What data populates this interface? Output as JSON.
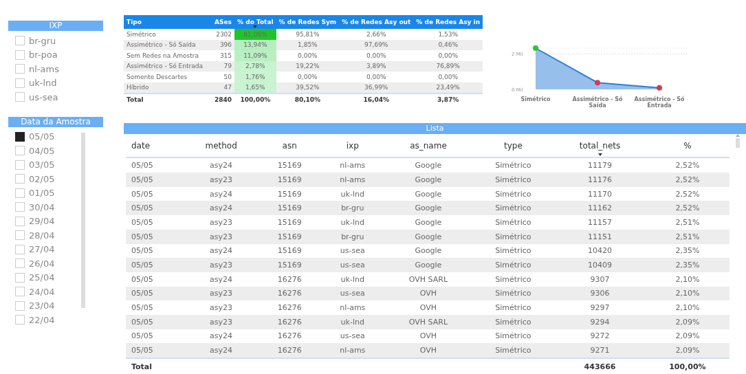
{
  "ixp_filter": {
    "title": "IXP",
    "items": [
      {
        "label": "br-gru",
        "checked": false
      },
      {
        "label": "br-poa",
        "checked": false
      },
      {
        "label": "nl-ams",
        "checked": false
      },
      {
        "label": "uk-lnd",
        "checked": false
      },
      {
        "label": "us-sea",
        "checked": false
      }
    ]
  },
  "date_filter": {
    "title": "Data da Amostra",
    "items": [
      {
        "label": "05/05",
        "checked": true
      },
      {
        "label": "04/05",
        "checked": false
      },
      {
        "label": "03/05",
        "checked": false
      },
      {
        "label": "02/05",
        "checked": false
      },
      {
        "label": "01/05",
        "checked": false
      },
      {
        "label": "30/04",
        "checked": false
      },
      {
        "label": "29/04",
        "checked": false
      },
      {
        "label": "28/04",
        "checked": false
      },
      {
        "label": "27/04",
        "checked": false
      },
      {
        "label": "26/04",
        "checked": false
      },
      {
        "label": "25/04",
        "checked": false
      },
      {
        "label": "24/04",
        "checked": false
      },
      {
        "label": "23/04",
        "checked": false
      },
      {
        "label": "22/04",
        "checked": false
      }
    ]
  },
  "summary_table": {
    "columns": [
      {
        "label": "Tipo",
        "sorted": false
      },
      {
        "label": "ASes",
        "sorted": false
      },
      {
        "label": "% do Total",
        "sorted": true
      },
      {
        "label": "% de Redes Sym",
        "sorted": false
      },
      {
        "label": "% de Redes Asy out",
        "sorted": false
      },
      {
        "label": "% de Redes Asy in",
        "sorted": false
      }
    ],
    "rows": [
      {
        "cells": [
          "Simétrico",
          "2302",
          "81,06%",
          "95,81%",
          "2,66%",
          "1,53%"
        ],
        "color": "#1fc42c"
      },
      {
        "cells": [
          "Assimétrico - Só Saída",
          "396",
          "13,94%",
          "1,85%",
          "97,69%",
          "0,46%"
        ],
        "color": "#b5eec0"
      },
      {
        "cells": [
          "Sem Redes na Amostra",
          "315",
          "11,09%",
          "0,00%",
          "0,00%",
          "0,00%"
        ],
        "color": "#b9efc3"
      },
      {
        "cells": [
          "Assimétrico - Só Entrada",
          "79",
          "2,78%",
          "19,22%",
          "3,89%",
          "76,89%"
        ],
        "color": "#c8f3d0"
      },
      {
        "cells": [
          "Somente Descartes",
          "50",
          "1,76%",
          "0,00%",
          "0,00%",
          "0,00%"
        ],
        "color": "#c9f3d1"
      },
      {
        "cells": [
          "Híbrido",
          "47",
          "1,65%",
          "39,52%",
          "36,99%",
          "23,49%"
        ],
        "color": "#caf3d2"
      }
    ],
    "total": [
      "Total",
      "2840",
      "100,00%",
      "80,10%",
      "16,04%",
      "3,87%"
    ]
  },
  "chart": {
    "chart_data": {
      "type": "area",
      "categories": [
        "Simétrico",
        "Assimétrico - Só Saída",
        "Assimétrico - Só Entrada"
      ],
      "series": [
        {
          "color": "#2f7fd8",
          "values": [
            2.32,
            0.38,
            0.09
          ]
        }
      ],
      "ylim": [
        0,
        2.32
      ],
      "yticks": [
        {
          "value": 0,
          "label": "0 Mil"
        },
        {
          "value": 2,
          "label": "2 Mil"
        }
      ]
    }
  },
  "list": {
    "title": "Lista",
    "columns": [
      {
        "label": "date",
        "sorted": false
      },
      {
        "label": "method",
        "sorted": false
      },
      {
        "label": "asn",
        "sorted": false
      },
      {
        "label": "ixp",
        "sorted": false
      },
      {
        "label": "as_name",
        "sorted": false
      },
      {
        "label": "type",
        "sorted": false
      },
      {
        "label": "total_nets",
        "sorted": true
      },
      {
        "label": "%",
        "sorted": false
      }
    ],
    "rows": [
      [
        "05/05",
        "asy24",
        "15169",
        "nl-ams",
        "Google",
        "Simétrico",
        "11179",
        "2,52%"
      ],
      [
        "05/05",
        "asy23",
        "15169",
        "nl-ams",
        "Google",
        "Simétrico",
        "11176",
        "2,52%"
      ],
      [
        "05/05",
        "asy24",
        "15169",
        "uk-lnd",
        "Google",
        "Simétrico",
        "11170",
        "2,52%"
      ],
      [
        "05/05",
        "asy24",
        "15169",
        "br-gru",
        "Google",
        "Simétrico",
        "11162",
        "2,52%"
      ],
      [
        "05/05",
        "asy23",
        "15169",
        "uk-lnd",
        "Google",
        "Simétrico",
        "11157",
        "2,51%"
      ],
      [
        "05/05",
        "asy23",
        "15169",
        "br-gru",
        "Google",
        "Simétrico",
        "11151",
        "2,51%"
      ],
      [
        "05/05",
        "asy24",
        "15169",
        "us-sea",
        "Google",
        "Simétrico",
        "10420",
        "2,35%"
      ],
      [
        "05/05",
        "asy23",
        "15169",
        "us-sea",
        "Google",
        "Simétrico",
        "10409",
        "2,35%"
      ],
      [
        "05/05",
        "asy24",
        "16276",
        "uk-lnd",
        "OVH SARL",
        "Simétrico",
        "9307",
        "2,10%"
      ],
      [
        "05/05",
        "asy23",
        "16276",
        "us-sea",
        "OVH",
        "Simétrico",
        "9306",
        "2,10%"
      ],
      [
        "05/05",
        "asy23",
        "16276",
        "nl-ams",
        "OVH",
        "Simétrico",
        "9297",
        "2,10%"
      ],
      [
        "05/05",
        "asy23",
        "16276",
        "uk-lnd",
        "OVH SARL",
        "Simétrico",
        "9294",
        "2,09%"
      ],
      [
        "05/05",
        "asy24",
        "16276",
        "us-sea",
        "OVH",
        "Simétrico",
        "9272",
        "2,09%"
      ],
      [
        "05/05",
        "asy24",
        "16276",
        "nl-ams",
        "OVH",
        "Simétrico",
        "9271",
        "2,09%"
      ]
    ],
    "total": {
      "label": "Total",
      "total_nets": "443666",
      "percent": "100,00%"
    }
  }
}
